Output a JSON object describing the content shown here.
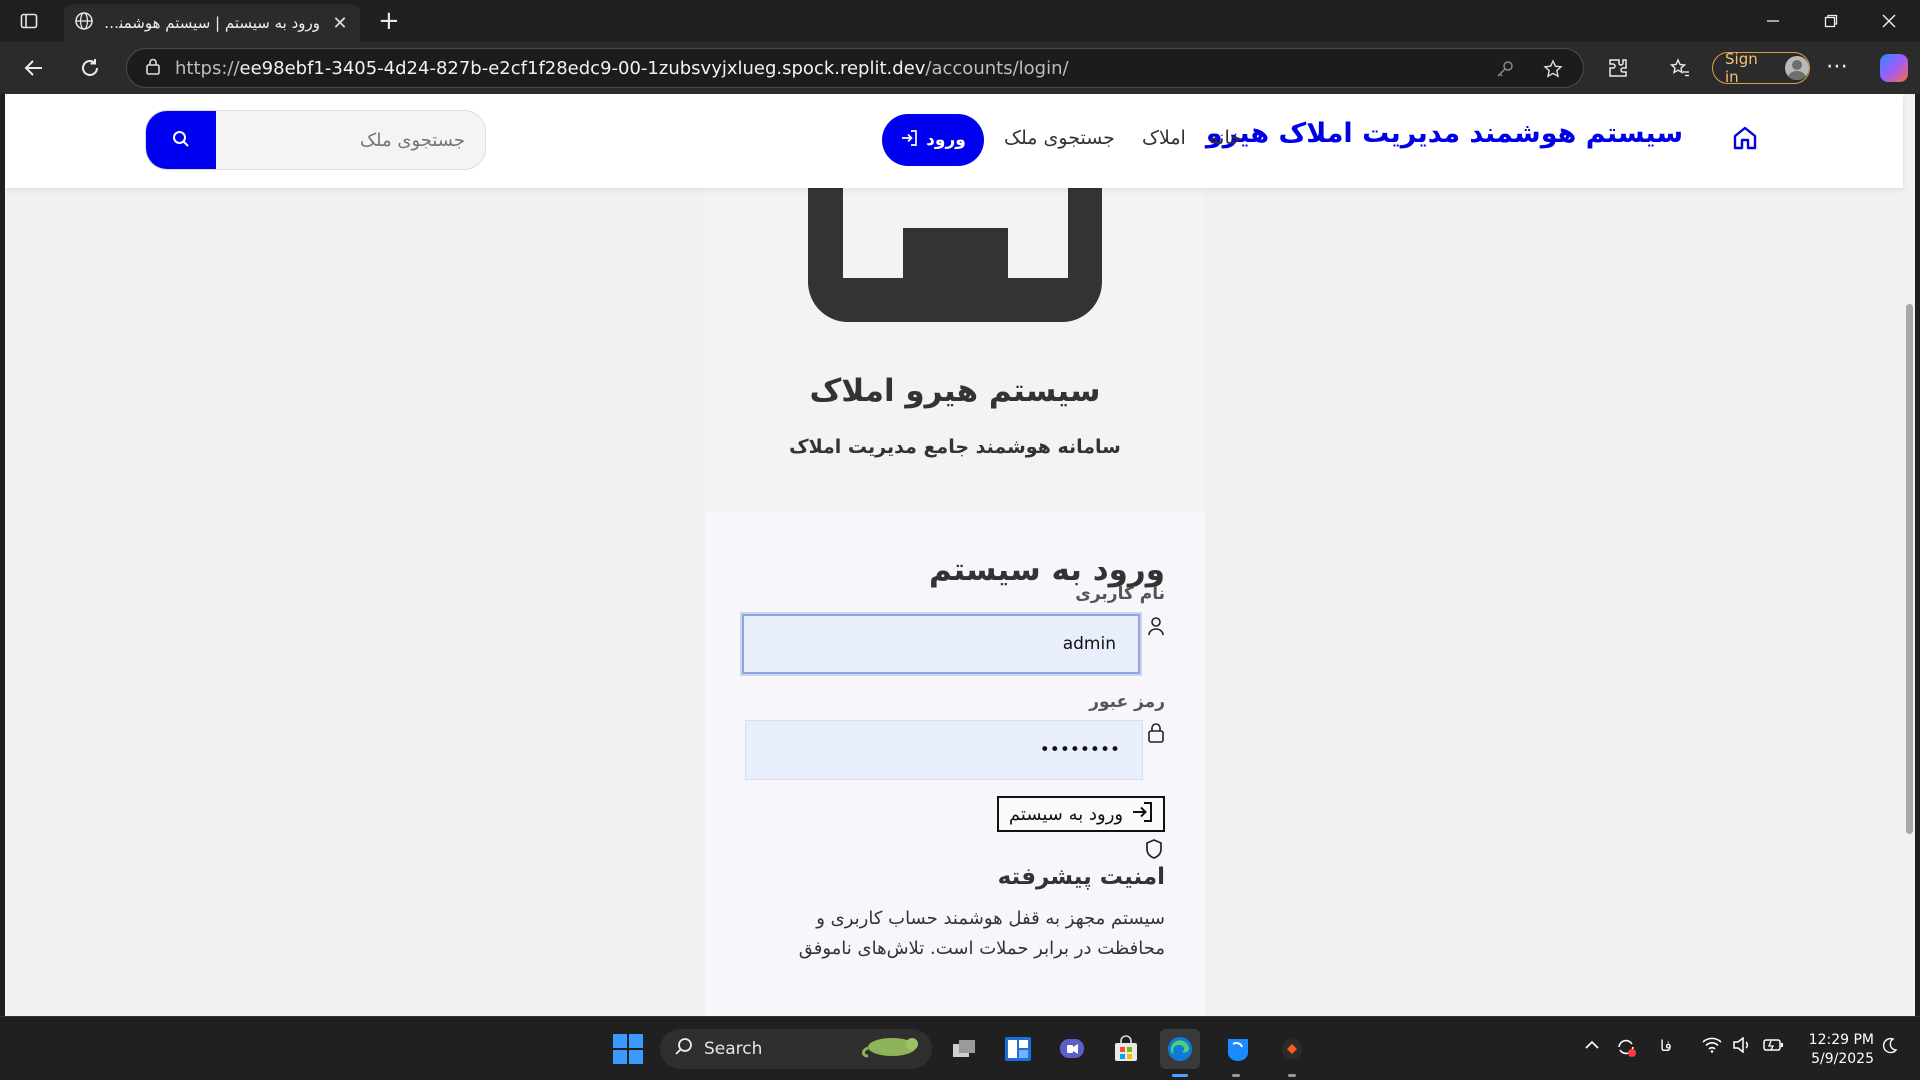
{
  "browser": {
    "tab_title": "ورود به سیستم | سیستم هوشمند مدیریت املاک هیرو",
    "url_scheme": "https://",
    "url_host": "ee98ebf1-3405-4d24-827b-e2cf1f28edc9-00-1zubsvyjxlueg.spock.replit.dev",
    "url_path": "/accounts/login/",
    "signin_label": "Sign in"
  },
  "header": {
    "brand": "سیستم هوشمند مدیریت املاک هیرو",
    "nav": {
      "home": "خانه",
      "properties": "املاک",
      "search_property": "جستجوی ملک"
    },
    "login_button": "ورود",
    "search_placeholder": "جستجوی ملک"
  },
  "card": {
    "app_title": "سیستم هیرو املاک",
    "app_subtitle": "سامانه هوشمند جامع مدیریت املاک",
    "form_title": "ورود به سیستم",
    "username_label": "نام کاربری",
    "username_value": "admin",
    "password_label": "رمز عبور",
    "password_value": "••••••••",
    "submit_label": "ورود به سیستم",
    "feature_title": "امنیت پیشرفته",
    "feature_text": "سیستم مجهز به قفل هوشمند حساب کاربری و محافظت در برابر حملات است. تلاش‌های ناموفق"
  },
  "taskbar": {
    "search_label": "Search",
    "language": "فا",
    "time": "12:29 PM",
    "date": "5/9/2025"
  },
  "colors": {
    "brand_blue": "#0000f0",
    "chrome_dark": "#1f1f1f"
  }
}
